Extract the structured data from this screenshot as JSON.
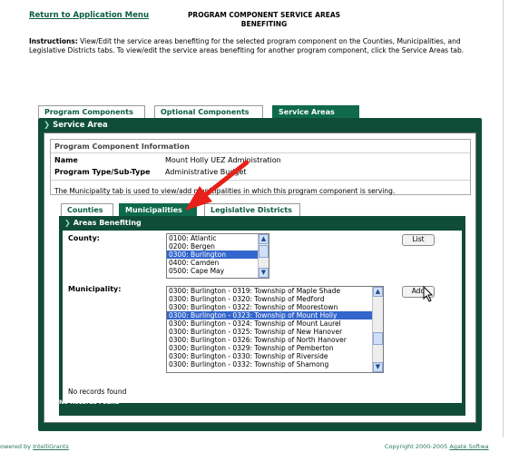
{
  "header": {
    "return_link": "Return to Application Menu",
    "title_line1": "PROGRAM COMPONENT SERVICE AREAS",
    "title_line2": "BENEFITING"
  },
  "instructions": {
    "label": "Instructions:",
    "text": " View/Edit the service areas benefiting for the selected program component on the Counties, Municipalities, and Legislative Districts tabs. To view/edit the service areas benefiting for another program component, click the Service Areas tab."
  },
  "main_tabs": [
    "Program Components",
    "Optional Components",
    "Service Areas"
  ],
  "service_area": {
    "header": "Service Area",
    "info_title": "Program Component Information",
    "name_label": "Name",
    "name_value": "Mount Holly UEZ Administration",
    "type_label": "Program Type/Sub-Type",
    "type_value": "Administrative Budget",
    "note": "The Municipality tab is used to view/add municipalities in which this program component is serving."
  },
  "sub_tabs": [
    "Counties",
    "Municipalities",
    "Legislative Districts"
  ],
  "areas": {
    "header": "Areas Benefiting",
    "county_label": "County:",
    "counties": [
      "0100: Atlantic",
      "0200: Bergen",
      "0300: Burlington",
      "0400: Camden",
      "0500: Cape May"
    ],
    "county_selected": 2,
    "list_button": "List",
    "municipality_label": "Municipality:",
    "municipalities": [
      "0300: Burlington - 0319: Township of Maple Shade",
      "0300: Burlington - 0320: Township of Medford",
      "0300: Burlington - 0322: Township of Moorestown",
      "0300: Burlington - 0323: Township of Mount Holly",
      "0300: Burlington - 0324: Township of Mount Laurel",
      "0300: Burlington - 0325: Township of New Hanover",
      "0300: Burlington - 0326: Township of North Hanover",
      "0300: Burlington - 0329: Township of Pemberton",
      "0300: Burlington - 0330: Township of Riverside",
      "0300: Burlington - 0332: Township of Shamong"
    ],
    "municipality_selected": 3,
    "add_button": "Add",
    "no_records": "No records found",
    "no_records_bar": "No Records Found"
  },
  "footer": {
    "left_prefix": "owered by ",
    "left_link": "IntelliGrants",
    "right_prefix": "Copyright 2000-2005 ",
    "right_link": "Agate Softwa"
  },
  "colors": {
    "dark_green": "#0f4d38",
    "tab_green": "#0f6a4b",
    "selection": "#3366cc",
    "arrow": "#e8201a"
  }
}
